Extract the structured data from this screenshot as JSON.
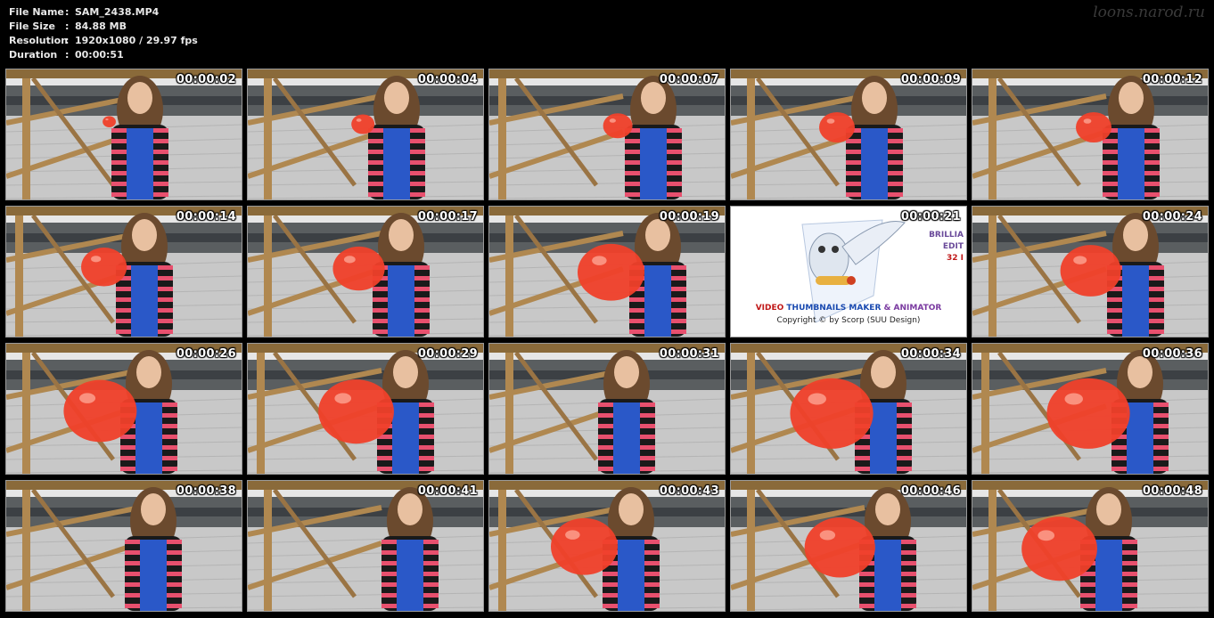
{
  "info": [
    {
      "key": "File Name",
      "sep": ":",
      "value": "SAM_2438.MP4"
    },
    {
      "key": "File Size",
      "sep": ":",
      "value": "84.88 MB"
    },
    {
      "key": "Resolution",
      "sep": ":",
      "value": "1920x1080 / 29.97 fps"
    },
    {
      "key": "Duration",
      "sep": ":",
      "value": "00:00:51"
    }
  ],
  "watermark": "loons.narod.ru",
  "thumbnails": [
    {
      "time": "00:00:02",
      "balloon": 0.02
    },
    {
      "time": "00:00:04",
      "balloon": 0.1
    },
    {
      "time": "00:00:07",
      "balloon": 0.15
    },
    {
      "time": "00:00:09",
      "balloon": 0.2
    },
    {
      "time": "00:00:12",
      "balloon": 0.2
    },
    {
      "time": "00:00:14",
      "balloon": 0.28
    },
    {
      "time": "00:00:17",
      "balloon": 0.33
    },
    {
      "time": "00:00:19",
      "balloon": 0.45
    },
    {
      "time": "00:00:21",
      "logo": true
    },
    {
      "time": "00:00:24",
      "balloon": 0.4
    },
    {
      "time": "00:00:26",
      "balloon": 0.5
    },
    {
      "time": "00:00:29",
      "balloon": 0.52
    },
    {
      "time": "00:00:31",
      "balloon": 0
    },
    {
      "time": "00:00:34",
      "balloon": 0.58
    },
    {
      "time": "00:00:36",
      "balloon": 0.58
    },
    {
      "time": "00:00:38",
      "balloon": 0
    },
    {
      "time": "00:00:41",
      "balloon": 0
    },
    {
      "time": "00:00:43",
      "balloon": 0.45
    },
    {
      "time": "00:00:46",
      "balloon": 0.48
    },
    {
      "time": "00:00:48",
      "balloon": 0.52
    }
  ],
  "logo": {
    "title_a": "VIDEO",
    "title_b": "THUMBNAILS MAKER",
    "title_c": "& ANIMATOR",
    "copyright": "Copyright © by Scorp (SUU Design)",
    "side_1": "BRILLIA",
    "side_2": "EDIT",
    "side_3": "32 I"
  },
  "colors": {
    "balloon": "#f0402a",
    "stripe_pink": "#e8506e",
    "stripe_dark": "#1a1a1a",
    "shirt": "#2a58c8",
    "hair": "#6b4a2e",
    "ground": "#c8c8c8",
    "wood": "#b08850",
    "sky": "#e6e6e6"
  }
}
